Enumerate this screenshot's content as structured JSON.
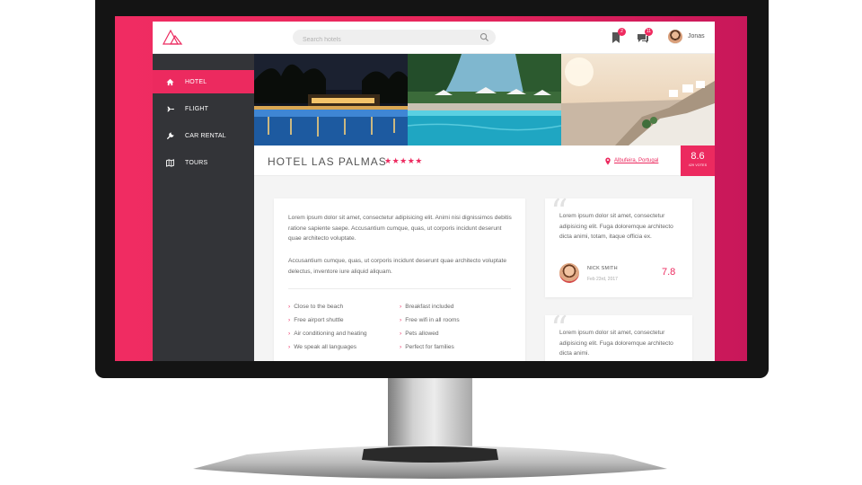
{
  "colors": {
    "accent": "#ec2a5f",
    "sidebar": "#333438",
    "bezel": "#141414"
  },
  "header": {
    "search_placeholder": "Search hotels",
    "notifications": [
      {
        "icon": "bookmark-icon",
        "badge": "2"
      },
      {
        "icon": "chat-icon",
        "badge": "11"
      }
    ],
    "user_name": "Jonas"
  },
  "sidebar": {
    "items": [
      {
        "label": "HOTEL",
        "icon": "home-icon",
        "active": true
      },
      {
        "label": "FLIGHT",
        "icon": "plane-icon",
        "active": false
      },
      {
        "label": "CAR RENTAL",
        "icon": "wrench-icon",
        "active": false
      },
      {
        "label": "TOURS",
        "icon": "map-icon",
        "active": false
      }
    ]
  },
  "hotel": {
    "name": "HOTEL LAS PALMAS",
    "stars": "★★★★★",
    "location": "Albufeira, Portugal",
    "score": "8.6",
    "score_caption": "429 VOTES"
  },
  "description": {
    "paragraphs": [
      "Lorem ipsum dolor sit amet, consectetur adipisicing elit. Animi nisi dignissimos debitis ratione sapiente saepe. Accusantium cumque, quas, ut corporis incidunt deserunt quae architecto voluptate.",
      "Accusantium cumque, quas, ut corporis incidunt deserunt quae architecto voluptate delectus, inventore iure aliquid aliquam."
    ],
    "features": [
      "Close to the beach",
      "Breakfast included",
      "Free airport shuttle",
      "Free wifi in all rooms",
      "Air conditioning and heating",
      "Pets allowed",
      "We speak all languages",
      "Perfect for families"
    ]
  },
  "reviews": [
    {
      "text": "Lorem ipsum dolor sit amet, consectetur adipisicing elit. Fuga doloremque architecto dicta animi, totam, itaque officia ex.",
      "name": "NICK SMITH",
      "date": "Feb 23rd, 2017",
      "score": "7.8"
    },
    {
      "text": "Lorem ipsum dolor sit amet, consectetur adipisicing elit. Fuga doloremque architecto dicta animi."
    }
  ]
}
